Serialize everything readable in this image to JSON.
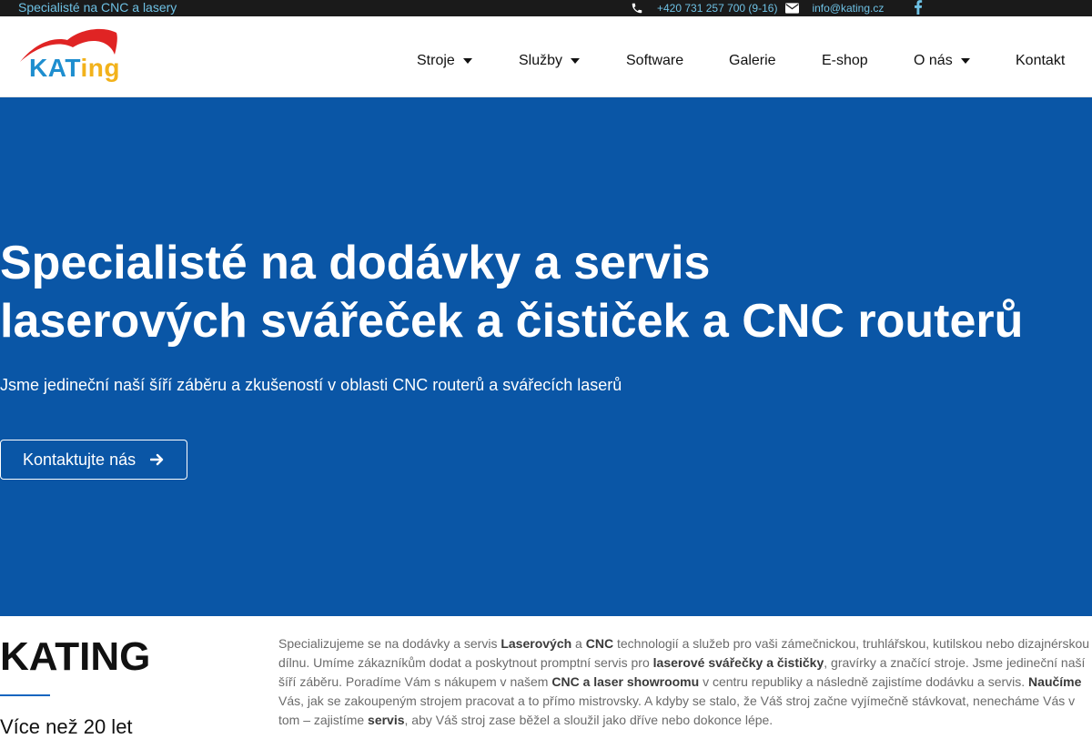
{
  "topbar": {
    "tagline": "Specialisté na CNC a lasery",
    "phone": "+420 731 257 700 (9-16)",
    "email": "info@kating.cz",
    "icons": [
      "phone-icon",
      "envelope-icon",
      "facebook-icon"
    ]
  },
  "logo": {
    "brand_main": "KAT",
    "brand_tail": "ing",
    "colors": {
      "arc": "#e02424",
      "kat": "#1e8ecf",
      "ing": "#f2b21b"
    }
  },
  "nav": {
    "items": [
      {
        "label": "Stroje",
        "dropdown": true
      },
      {
        "label": "Služby",
        "dropdown": true
      },
      {
        "label": "Software",
        "dropdown": false
      },
      {
        "label": "Galerie",
        "dropdown": false
      },
      {
        "label": "E-shop",
        "dropdown": false
      },
      {
        "label": "O nás",
        "dropdown": true
      },
      {
        "label": "Kontakt",
        "dropdown": false
      }
    ]
  },
  "hero": {
    "title_line1": "Specialisté na dodávky a servis",
    "title_line2": "laserových svářeček a čističek a CNC routerů",
    "subtitle": "Jsme jedineční naší šíří záběru a zkušeností v oblasti CNC routerů a svářecích laserů",
    "cta_label": "Kontaktujte nás",
    "background": "#0a56a6"
  },
  "about": {
    "title": "KATING",
    "years": "Více než 20 let",
    "p1": "Specializujeme se na dodávky a servis ",
    "b1": "Laserových",
    "p2": " a ",
    "b2": "CNC",
    "p3": " technologií a služeb pro vaši zámečnickou, truhlářskou, kutilskou nebo dizajnérskou dílnu. Umíme zákazníkům dodat a poskytnout promptní servis pro ",
    "b3": "laserové svářečky a čističky",
    "p4": ", gravírky a značící stroje. Jsme jedineční naší šíří záběru. Poradíme Vám s nákupem v našem ",
    "b4": "CNC a laser showroomu",
    "p5": " v centru republiky a následně zajistíme dodávku a servis. ",
    "b5": "Naučíme",
    "p6": " Vás, jak se zakoupeným strojem pracovat a to přímo mistrovsky. A kdyby se stalo, že Váš stroj začne vyjímečně stávkovat, nenecháme Vás v tom – zajistíme ",
    "b6": "servis",
    "p7": ", aby Váš stroj zase běžel a sloužil jako dříve nebo dokonce lépe."
  }
}
